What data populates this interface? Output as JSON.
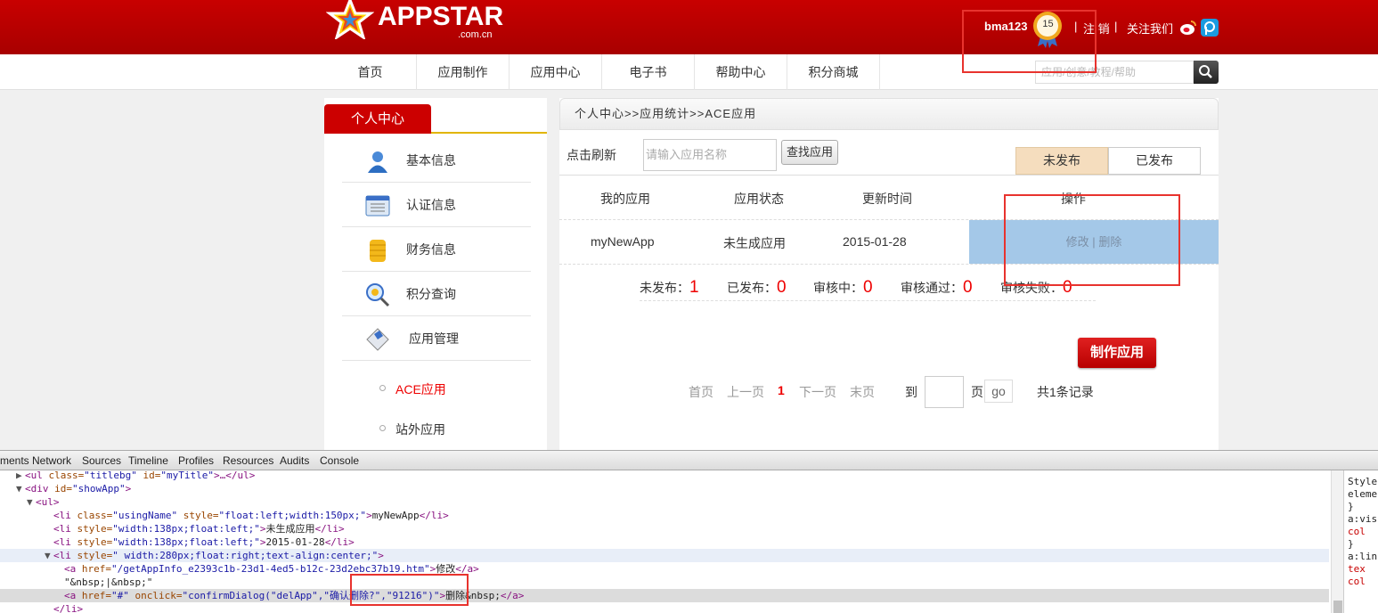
{
  "header": {
    "logo_text": "APPSTAR",
    "logo_sub": ".com.cn",
    "username": "bma123",
    "level": "15",
    "sep": "|",
    "logout": "注 销",
    "follow": "关注我们"
  },
  "nav": {
    "items": [
      "首页",
      "应用制作",
      "应用中心",
      "电子书",
      "帮助中心",
      "积分商城"
    ],
    "search_placeholder": "应用/创意/教程/帮助"
  },
  "sidebar": {
    "title": "个人中心",
    "items": [
      "基本信息",
      "认证信息",
      "财务信息",
      "积分查询",
      "应用管理"
    ],
    "sub_items": [
      "ACE应用",
      "站外应用"
    ]
  },
  "main": {
    "breadcrumb": "个人中心>>应用统计>>ACE应用",
    "refresh_label": "点击刷新",
    "search_placeholder": "请输入应用名称",
    "find_button": "查找应用",
    "tab_unpublished": "未发布",
    "tab_published": "已发布",
    "columns": [
      "我的应用",
      "应用状态",
      "更新时间",
      "操作"
    ],
    "rows": [
      {
        "name": "myNewApp",
        "status": "未生成应用",
        "updated": "2015-01-28",
        "edit": "修改",
        "divider": "|",
        "delete": "删除"
      }
    ],
    "stats": [
      {
        "label": "未发布：",
        "value": "1"
      },
      {
        "label": "已发布：",
        "value": "0"
      },
      {
        "label": "审核中：",
        "value": "0"
      },
      {
        "label": "审核通过：",
        "value": "0"
      },
      {
        "label": "审核失败：",
        "value": "0"
      }
    ],
    "make_button": "制作应用",
    "pager": {
      "first": "首页",
      "prev": "上一页",
      "current": "1",
      "next": "下一页",
      "last": "末页",
      "to": "到",
      "page": "页",
      "go": "go",
      "total": "共1条记录"
    }
  },
  "devtools": {
    "tabs": [
      "ments",
      "Network",
      "Sources",
      "Timeline",
      "Profiles",
      "Resources",
      "Audits",
      "Console"
    ],
    "styles_lines": [
      "Style",
      "eleme",
      "}",
      "a:vis",
      "col",
      "}",
      "a:lin",
      "tex",
      "col"
    ],
    "code": [
      {
        "tri": "▶",
        "indent": 20,
        "parts": [
          [
            "tag",
            "<ul "
          ],
          [
            "attr",
            "class="
          ],
          [
            "val",
            "\"titlebg\" "
          ],
          [
            "attr",
            "id="
          ],
          [
            "val",
            "\"myTitle\""
          ],
          [
            "tag",
            ">…</ul>"
          ]
        ]
      },
      {
        "tri": "▼",
        "indent": 20,
        "parts": [
          [
            "tag",
            "<div "
          ],
          [
            "attr",
            "id="
          ],
          [
            "val",
            "\"showApp\""
          ],
          [
            "tag",
            ">"
          ]
        ]
      },
      {
        "tri": "▼",
        "indent": 32,
        "parts": [
          [
            "tag",
            "<ul>"
          ]
        ]
      },
      {
        "tri": "",
        "indent": 52,
        "parts": [
          [
            "tag",
            "<li "
          ],
          [
            "attr",
            "class="
          ],
          [
            "val",
            "\"usingName\" "
          ],
          [
            "attr",
            "style="
          ],
          [
            "val",
            "\"float:left;width:150px;\""
          ],
          [
            "tag",
            ">"
          ],
          [
            "txt",
            "myNewApp"
          ],
          [
            "tag",
            "</li>"
          ]
        ]
      },
      {
        "tri": "",
        "indent": 52,
        "parts": [
          [
            "tag",
            "<li "
          ],
          [
            "attr",
            "style="
          ],
          [
            "val",
            "\"width:138px;float:left;\""
          ],
          [
            "tag",
            ">"
          ],
          [
            "txt",
            "未生成应用"
          ],
          [
            "tag",
            "</li>"
          ]
        ]
      },
      {
        "tri": "",
        "indent": 52,
        "parts": [
          [
            "tag",
            "<li "
          ],
          [
            "attr",
            "style="
          ],
          [
            "val",
            "\"width:138px;float:left;\""
          ],
          [
            "tag",
            ">"
          ],
          [
            "txt",
            "2015-01-28"
          ],
          [
            "tag",
            "</li>"
          ]
        ]
      },
      {
        "tri": "▼",
        "indent": 52,
        "parts": [
          [
            "tag",
            "<li "
          ],
          [
            "attr",
            "style="
          ],
          [
            "val",
            "\" width:280px;float:right;text-align:center;\""
          ],
          [
            "tag",
            ">"
          ]
        ]
      },
      {
        "tri": "",
        "indent": 64,
        "parts": [
          [
            "tag",
            "<a "
          ],
          [
            "attr",
            "href="
          ],
          [
            "val",
            "\"/getAppInfo_e2393c1b-23d1-4ed5-b12c-23d2ebc37b19.htm\""
          ],
          [
            "tag",
            ">"
          ],
          [
            "txt",
            "修改"
          ],
          [
            "tag",
            "</a>"
          ]
        ]
      },
      {
        "tri": "",
        "indent": 64,
        "parts": [
          [
            "txt",
            "\"&nbsp;|&nbsp;\""
          ]
        ]
      },
      {
        "tri": "",
        "indent": 64,
        "parts": [
          [
            "tag",
            "<a "
          ],
          [
            "attr",
            "href="
          ],
          [
            "val",
            "\"#\" "
          ],
          [
            "attr",
            "onclick="
          ],
          [
            "val",
            "\"confirmDialog(\"delApp\",\"确认删除?\",\"91216\")\""
          ],
          [
            "tag",
            ">"
          ],
          [
            "txt",
            "删除&nbsp;"
          ],
          [
            "tag",
            "</a>"
          ]
        ]
      },
      {
        "tri": "",
        "indent": 52,
        "parts": [
          [
            "tag",
            "</li>"
          ]
        ]
      }
    ]
  },
  "colors": {
    "brand_red": "#c80000",
    "highlight_blue": "#a4c8e8",
    "tab_active": "#f5ddbe",
    "annotation_red": "#e8332e"
  }
}
